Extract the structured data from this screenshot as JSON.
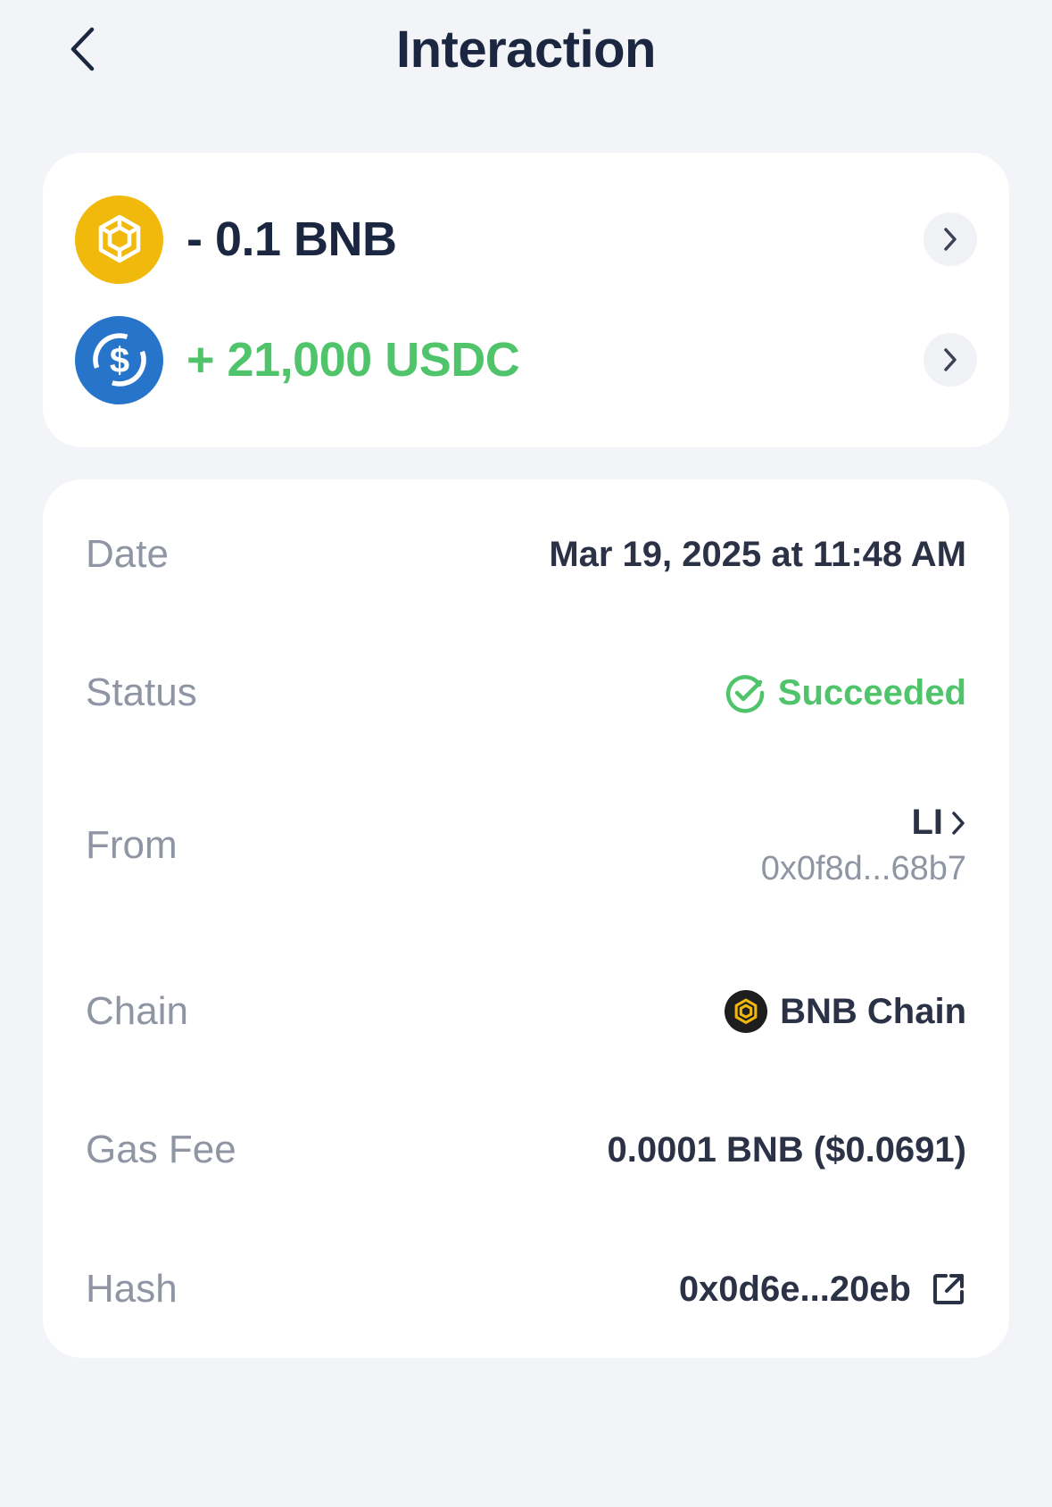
{
  "header": {
    "title": "Interaction"
  },
  "amounts": [
    {
      "text": "- 0.1 BNB",
      "token": "BNB",
      "direction": "out",
      "icon": "bnb-icon"
    },
    {
      "text": "+ 21,000 USDC",
      "token": "USDC",
      "direction": "in",
      "icon": "usdc-icon"
    }
  ],
  "details": {
    "date": {
      "label": "Date",
      "value": "Mar 19, 2025 at 11:48 AM"
    },
    "status": {
      "label": "Status",
      "value": "Succeeded"
    },
    "from": {
      "label": "From",
      "name": "LI",
      "address": "0x0f8d...68b7"
    },
    "chain": {
      "label": "Chain",
      "value": "BNB Chain"
    },
    "gas_fee": {
      "label": "Gas Fee",
      "value": "0.0001 BNB ($0.0691)"
    },
    "hash": {
      "label": "Hash",
      "value": "0x0d6e...20eb"
    }
  },
  "colors": {
    "background": "#f2f4f8",
    "card": "#ffffff",
    "primary_text": "#1b2641",
    "muted_text": "#8f95a3",
    "success": "#4fc46b",
    "bnb_yellow": "#f0b90b",
    "usdc_blue": "#2775ca"
  }
}
